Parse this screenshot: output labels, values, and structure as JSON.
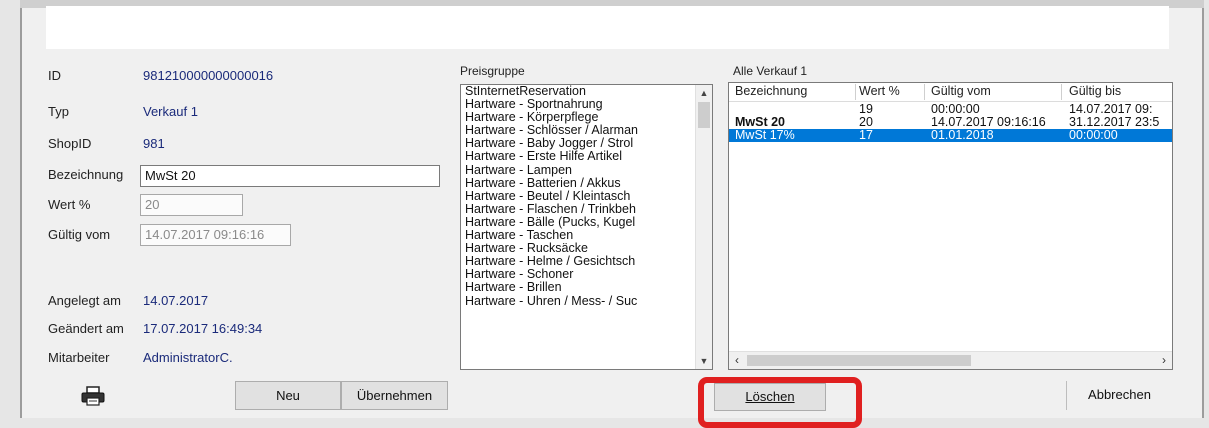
{
  "details": {
    "id_label": "ID",
    "id_value": "981210000000000016",
    "typ_label": "Typ",
    "typ_value": "Verkauf 1",
    "shop_label": "ShopID",
    "shop_value": "981",
    "bezeichnung_label": "Bezeichnung",
    "bezeichnung_value": "MwSt 20",
    "wert_label": "Wert %",
    "wert_value": "20",
    "gueltig_label": "Gültig vom",
    "gueltig_value": "14.07.2017 09:16:16",
    "angelegt_label": "Angelegt am",
    "angelegt_value": "14.07.2017",
    "geaendert_label": "Geändert am",
    "geaendert_value": "17.07.2017 16:49:34",
    "mitarbeiter_label": "Mitarbeiter",
    "mitarbeiter_value": "AdministratorC."
  },
  "preisgruppe": {
    "label": "Preisgruppe",
    "items": [
      "StInternetReservation",
      "Hartware - Sportnahrung",
      "Hartware - Körperpflege",
      "Hartware - Schlösser / Alarman",
      "Hartware - Baby Jogger / Strol",
      "Hartware - Erste Hilfe Artikel",
      "Hartware - Lampen",
      "Hartware - Batterien / Akkus",
      "Hartware - Beutel / Kleintasch",
      "Hartware - Flaschen / Trinkbeh",
      "Hartware - Bälle (Pucks, Kugel",
      "Hartware - Taschen",
      "Hartware - Rucksäcke",
      "Hartware - Helme / Gesichtsch",
      "Hartware - Schoner",
      "Hartware - Brillen",
      "Hartware - Uhren / Mess- / Suc"
    ]
  },
  "grid": {
    "title": "Alle Verkauf 1",
    "columns": [
      "Bezeichnung",
      "Wert %",
      "Gültig vom",
      "Gültig bis"
    ],
    "rows": [
      {
        "name": "",
        "wert": "19",
        "von": "00:00:00",
        "bis": "14.07.2017 09:",
        "bold": false,
        "selected": false
      },
      {
        "name": "MwSt 20",
        "wert": "20",
        "von": "14.07.2017 09:16:16",
        "bis": "31.12.2017 23:5",
        "bold": true,
        "selected": false
      },
      {
        "name": "MwSt 17%",
        "wert": "17",
        "von": "01.01.2018",
        "bis": "00:00:00",
        "bold": false,
        "selected": true
      }
    ]
  },
  "buttons": {
    "neu": "Neu",
    "uebernehmen": "Übernehmen",
    "loeschen": "Löschen",
    "abbrechen": "Abbrechen"
  },
  "highlight_color": "#e02020"
}
